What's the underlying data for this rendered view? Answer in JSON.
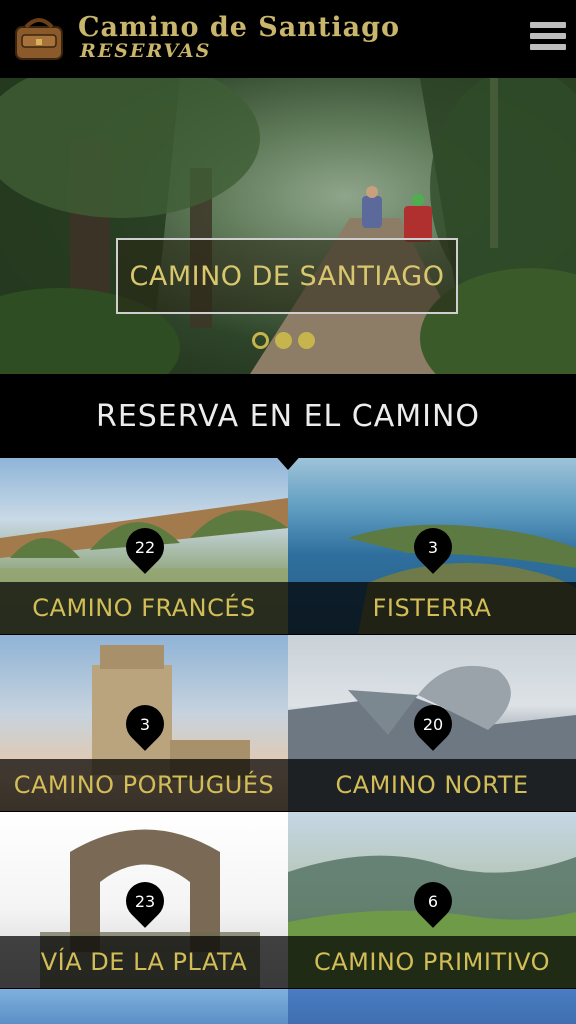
{
  "header": {
    "title": "Camino de Santiago",
    "subtitle": "RESERVAS",
    "logo_icon": "backpack-icon",
    "menu_icon": "hamburger-menu-icon"
  },
  "hero": {
    "caption": "CAMINO DE SANTIAGO",
    "slides": 3,
    "active_slide": 1
  },
  "section": {
    "title": "RESERVA EN EL CAMINO"
  },
  "routes": [
    {
      "name": "CAMINO FRANCÉS",
      "count": "22"
    },
    {
      "name": "FISTERRA",
      "count": "3"
    },
    {
      "name": "CAMINO PORTUGUÉS",
      "count": "3"
    },
    {
      "name": "CAMINO NORTE",
      "count": "20"
    },
    {
      "name": "VÍA DE LA PLATA",
      "count": "23"
    },
    {
      "name": "CAMINO PRIMITIVO",
      "count": "6"
    }
  ],
  "colors": {
    "accent_gold": "#d2bd57",
    "header_bg": "#000000"
  }
}
